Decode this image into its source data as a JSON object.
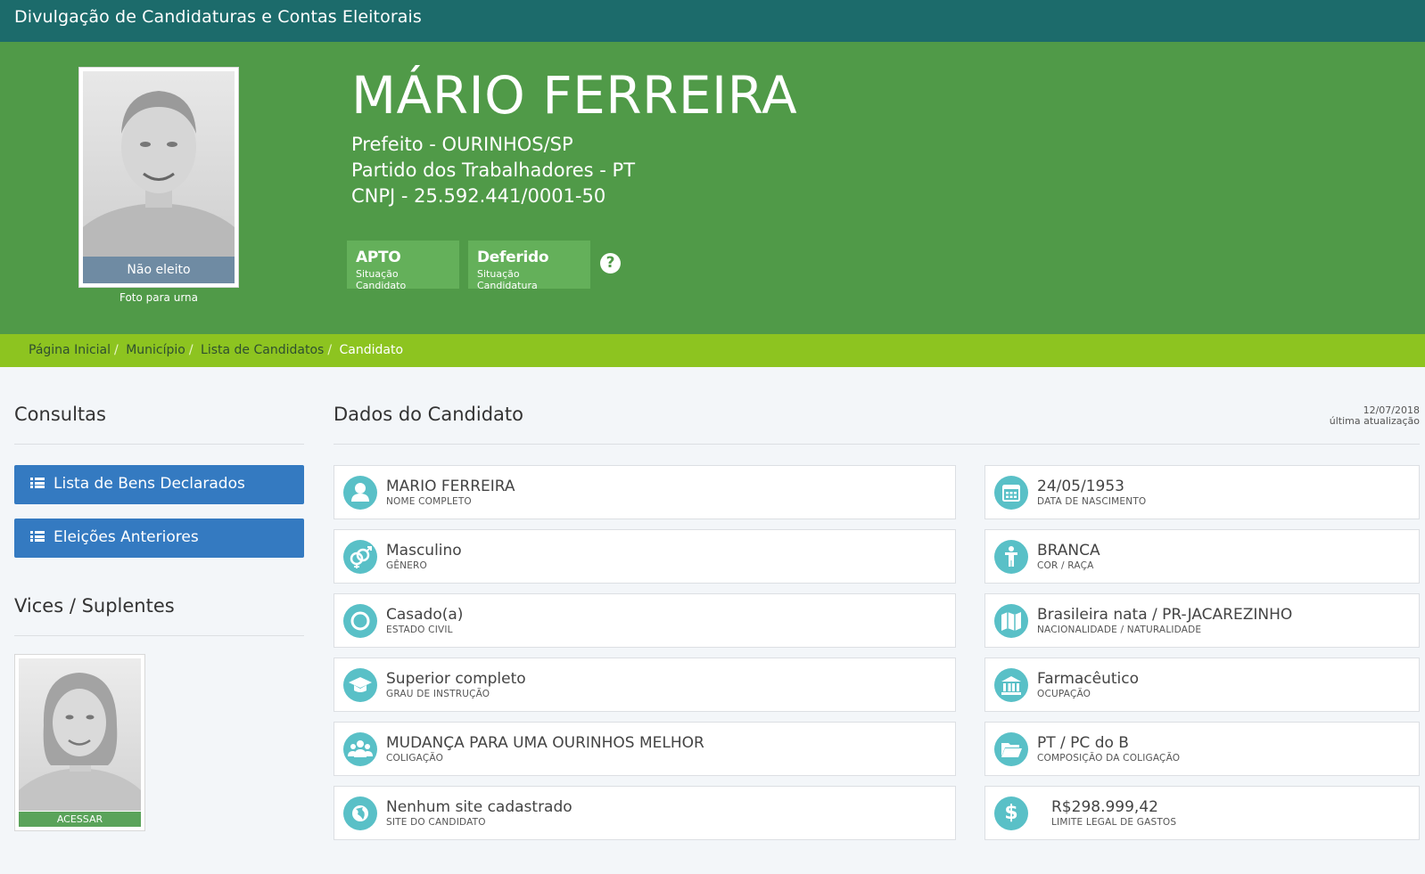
{
  "header": {
    "title": "Divulgação de Candidaturas e Contas Eleitorais"
  },
  "candidate": {
    "name": "MÁRIO FERREIRA",
    "office": "Prefeito - OURINHOS/SP",
    "party": "Partido dos Trabalhadores - PT",
    "cnpj": "CNPJ - 25.592.441/0001-50",
    "photo_status": "Não eleito",
    "photo_caption": "Foto para urna",
    "badges": [
      {
        "title": "APTO",
        "subtitle": "Situação Candidato"
      },
      {
        "title": "Deferido",
        "subtitle": "Situação Candidatura"
      }
    ],
    "help_symbol": "?"
  },
  "breadcrumb": {
    "items": [
      "Página Inicial",
      "Município",
      "Lista de Candidatos"
    ],
    "current": "Candidato",
    "separator": "/"
  },
  "sidebar": {
    "consultas_title": "Consultas",
    "buttons": [
      "Lista de Bens Declarados",
      "Eleições Anteriores"
    ],
    "vices_title": "Vices / Suplentes",
    "vice_button": "ACESSAR"
  },
  "main": {
    "title": "Dados do Candidato",
    "update_date": "12/07/2018",
    "update_label": "última atualização",
    "left_fields": [
      {
        "value": "MARIO FERREIRA",
        "label": "NOME COMPLETO",
        "icon": "user-icon"
      },
      {
        "value": "Masculino",
        "label": "GÊNERO",
        "icon": "gender-icon"
      },
      {
        "value": "Casado(a)",
        "label": "ESTADO CIVIL",
        "icon": "ring-icon"
      },
      {
        "value": "Superior completo",
        "label": "GRAU DE INSTRUÇÃO",
        "icon": "graduation-cap-icon"
      },
      {
        "value": "MUDANÇA PARA UMA OURINHOS MELHOR",
        "label": "COLIGAÇÃO",
        "icon": "group-icon"
      },
      {
        "value": "Nenhum site cadastrado",
        "label": "SITE DO CANDIDATO",
        "icon": "globe-icon"
      }
    ],
    "right_fields": [
      {
        "value": "24/05/1953",
        "label": "DATA DE NASCIMENTO",
        "icon": "calendar-icon"
      },
      {
        "value": "BRANCA",
        "label": "COR / RAÇA",
        "icon": "person-icon"
      },
      {
        "value": "Brasileira nata / PR-JACAREZINHO",
        "label": "NACIONALIDADE / NATURALIDADE",
        "icon": "map-icon"
      },
      {
        "value": "Farmacêutico",
        "label": "OCUPAÇÃO",
        "icon": "bank-icon"
      },
      {
        "value": "PT / PC do B",
        "label": "COMPOSIÇÃO DA COLIGAÇÃO",
        "icon": "folder-icon"
      },
      {
        "value": "R$298.999,42",
        "label": "LIMITE LEGAL DE GASTOS",
        "icon": "dollar-icon"
      }
    ]
  },
  "colors": {
    "topbar": "#1c6b6b",
    "hero": "#509a48",
    "breadcrumb_bar": "#8dc420",
    "button_blue": "#347ac1",
    "icon_teal": "#59c0c7"
  }
}
